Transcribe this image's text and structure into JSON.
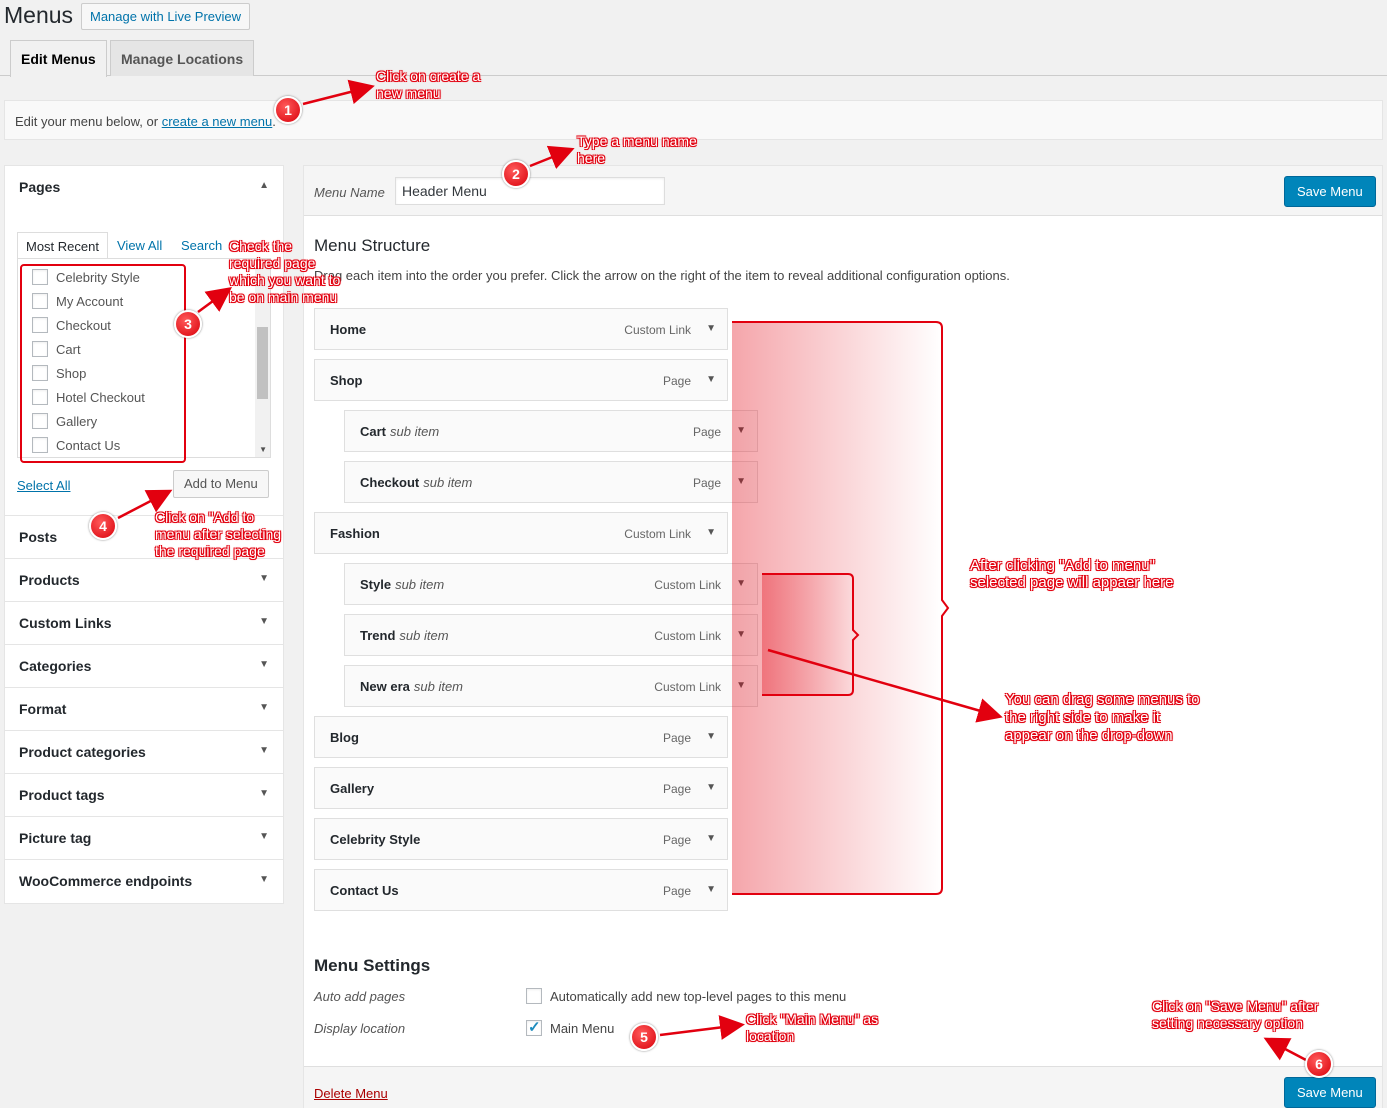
{
  "header": {
    "title": "Menus",
    "live_preview": "Manage with Live Preview"
  },
  "tabs": [
    {
      "label": "Edit Menus"
    },
    {
      "label": "Manage Locations"
    }
  ],
  "notice": {
    "prefix": "Edit your menu below, or ",
    "link": "create a new menu",
    "suffix": "."
  },
  "left": {
    "pages_title": "Pages",
    "pages_tabs": [
      "Most Recent",
      "View All",
      "Search"
    ],
    "pages": [
      "Celebrity Style",
      "My Account",
      "Checkout",
      "Cart",
      "Shop",
      "Hotel Checkout",
      "Gallery",
      "Contact Us"
    ],
    "select_all": "Select All",
    "add_to_menu": "Add to Menu",
    "sections": [
      "Posts",
      "Products",
      "Custom Links",
      "Categories",
      "Format",
      "Product categories",
      "Product tags",
      "Picture tag",
      "WooCommerce endpoints"
    ]
  },
  "editor": {
    "menu_name_label": "Menu Name",
    "menu_name_value": "Header Menu",
    "save_label": "Save Menu",
    "structure_title": "Menu Structure",
    "structure_desc": "Drag each item into the order you prefer. Click the arrow on the right of the item to reveal additional configuration options.",
    "items": [
      {
        "title": "Home",
        "sub": "",
        "type": "Custom Link"
      },
      {
        "title": "Shop",
        "sub": "",
        "type": "Page"
      },
      {
        "title": "Cart",
        "sub": "sub item",
        "type": "Page"
      },
      {
        "title": "Checkout",
        "sub": "sub item",
        "type": "Page"
      },
      {
        "title": "Fashion",
        "sub": "",
        "type": "Custom Link"
      },
      {
        "title": "Style",
        "sub": "sub item",
        "type": "Custom Link"
      },
      {
        "title": "Trend",
        "sub": "sub item",
        "type": "Custom Link"
      },
      {
        "title": "New era",
        "sub": "sub item",
        "type": "Custom Link"
      },
      {
        "title": "Blog",
        "sub": "",
        "type": "Page"
      },
      {
        "title": "Gallery",
        "sub": "",
        "type": "Page"
      },
      {
        "title": "Celebrity Style",
        "sub": "",
        "type": "Page"
      },
      {
        "title": "Contact Us",
        "sub": "",
        "type": "Page"
      }
    ],
    "settings_title": "Menu Settings",
    "auto_add_label": "Auto add pages",
    "auto_add_option": "Automatically add new top-level pages to this menu",
    "auto_add_checked": false,
    "display_location_label": "Display location",
    "display_location_option": "Main Menu",
    "display_location_checked": true,
    "delete_label": "Delete Menu"
  },
  "annotations": {
    "a1": "Click on create a new menu",
    "a2": "Type a menu name here",
    "a3": "Check the required page which you want to be on main menu",
    "a4": "Click on \"Add to menu after selecting the required page",
    "a_after": "After clicking \"Add to menu\" selected page will appaer here",
    "a_drag": "You can drag some menus to the right side to make it appear on the drop-down",
    "a5": "Click \"Main Menu\" as location",
    "a6": "Click on \"Save Menu\" after setting necessary option",
    "badges": [
      "1",
      "2",
      "3",
      "4",
      "5",
      "6"
    ],
    "color": "#e2000f"
  },
  "colors": {
    "primary_button": "#0085ba",
    "link": "#0073aa",
    "delete": "#a00000"
  }
}
